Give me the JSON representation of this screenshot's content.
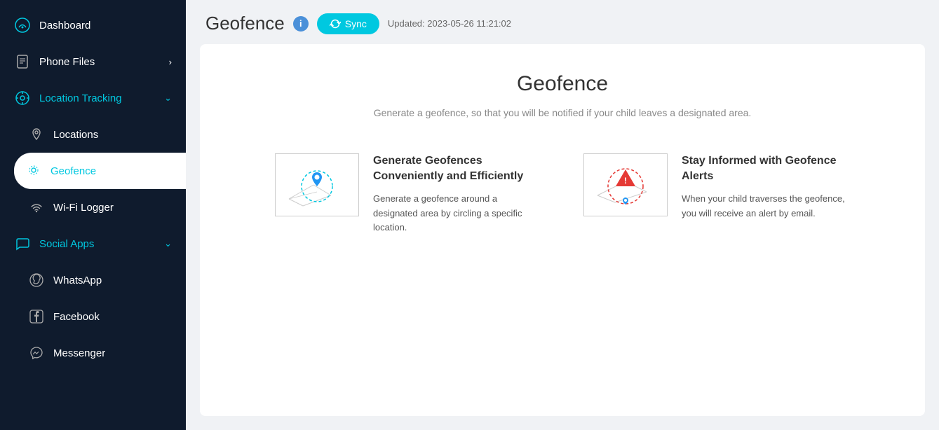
{
  "sidebar": {
    "items": [
      {
        "id": "dashboard",
        "label": "Dashboard",
        "icon": "dashboard-icon",
        "active": false
      },
      {
        "id": "phone-files",
        "label": "Phone Files",
        "icon": "phone-files-icon",
        "hasArrow": true,
        "active": false
      },
      {
        "id": "location-tracking",
        "label": "Location Tracking",
        "icon": "location-tracking-icon",
        "hasChevron": true,
        "active": true,
        "expanded": true
      },
      {
        "id": "locations",
        "label": "Locations",
        "icon": "locations-icon",
        "sub": true
      },
      {
        "id": "geofence",
        "label": "Geofence",
        "icon": "geofence-icon",
        "sub": true,
        "activeSub": true
      },
      {
        "id": "wifi-logger",
        "label": "Wi-Fi Logger",
        "icon": "wifi-icon",
        "sub": true
      },
      {
        "id": "social-apps",
        "label": "Social Apps",
        "icon": "social-apps-icon",
        "hasChevron": true,
        "active": true
      },
      {
        "id": "whatsapp",
        "label": "WhatsApp",
        "icon": "whatsapp-icon",
        "sub": true
      },
      {
        "id": "facebook",
        "label": "Facebook",
        "icon": "facebook-icon",
        "sub": true
      },
      {
        "id": "messenger",
        "label": "Messenger",
        "icon": "messenger-icon",
        "sub": true
      }
    ]
  },
  "header": {
    "title": "Geofence",
    "info_label": "i",
    "sync_label": "Sync",
    "updated_text": "Updated: 2023-05-26 11:21:02"
  },
  "main": {
    "card_title": "Geofence",
    "card_subtitle": "Generate a geofence, so that you will be notified if your child leaves a designated area.",
    "feature1_title": "Generate Geofences Conveniently and Efficiently",
    "feature1_desc": "Generate a geofence around a designated area by circling a specific location.",
    "feature2_title": "Stay Informed with Geofence Alerts",
    "feature2_desc": "When your child traverses the geofence, you will receive an alert by email."
  }
}
